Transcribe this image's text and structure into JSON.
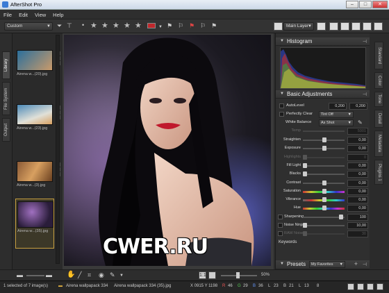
{
  "window": {
    "title": "AfterShot Pro",
    "min": "–",
    "max": "□",
    "close": "✕"
  },
  "menu": [
    "File",
    "Edit",
    "View",
    "Help"
  ],
  "toolbar": {
    "preset_dropdown": "Custom",
    "layer_dropdown": "Main Layer",
    "rating_stars": 5,
    "label_color": "#c0282c"
  },
  "left_tabs": [
    "Library",
    "File System",
    "Output"
  ],
  "thumbnails": [
    {
      "caption": "Airena w...(20).jpg",
      "colors": [
        "#2b6f9c",
        "#c99a6a"
      ]
    },
    {
      "caption": "Airena w...(23).jpg",
      "colors": [
        "#4c8ab8",
        "#e0e0d8"
      ]
    },
    {
      "caption": "Airena w...(3).jpg",
      "colors": [
        "#8a5a36",
        "#d8a060"
      ]
    },
    {
      "caption": "Airena w...(35).jpg",
      "colors": [
        "#2a1d3a",
        "#a070c0"
      ],
      "selected": true
    }
  ],
  "viewer": {
    "watermark": "CWER.RU",
    "zoom": "50%",
    "ratio_label": "1:1"
  },
  "panels": {
    "histogram": "Histogram",
    "basic": "Basic Adjustments",
    "presets": "Presets",
    "presets_dropdown": "My Favorites",
    "keywords": "Keywords"
  },
  "autolevel": {
    "label": "AutoLevel",
    "low": "0,200",
    "high": "0,200"
  },
  "perfectly_clear": {
    "label": "Perfectly Clear",
    "value": "Tint Off"
  },
  "white_balance": {
    "label": "White Balance",
    "value": "As Shot"
  },
  "temp": {
    "label": "Temp",
    "value": "5001"
  },
  "sliders": [
    {
      "label": "Straighten",
      "value": "0,00",
      "knob": 0.5,
      "enabled": true
    },
    {
      "label": "Exposure",
      "value": "0,00",
      "knob": 0.5,
      "enabled": true
    },
    {
      "label": "Highlights",
      "value": "0",
      "knob": 0.0,
      "enabled": false
    },
    {
      "label": "Fill Light",
      "value": "0,00",
      "knob": 0.0,
      "enabled": true
    },
    {
      "label": "Blacks",
      "value": "0,00",
      "knob": 0.0,
      "enabled": true
    },
    {
      "label": "Contrast",
      "value": "0,00",
      "knob": 0.5,
      "enabled": true
    },
    {
      "label": "Saturation",
      "value": "0,00",
      "knob": 0.5,
      "enabled": true
    },
    {
      "label": "Vibrance",
      "value": "0,00",
      "knob": 0.5,
      "enabled": true
    },
    {
      "label": "Hue",
      "value": "0,00",
      "knob": 0.5,
      "enabled": true
    },
    {
      "label": "Sharpening",
      "value": "100",
      "knob": 0.92,
      "enabled": true
    },
    {
      "label": "Noise Ninja",
      "value": "10,00",
      "knob": 0.0,
      "enabled": true
    },
    {
      "label": "RAW Noise",
      "value": "30",
      "knob": 0.0,
      "enabled": false
    }
  ],
  "right_tabs": [
    "Standard",
    "Color",
    "Tone",
    "Detail",
    "Metadata",
    "Plugins 1"
  ],
  "status": {
    "selection": "1 selected of 7 image(s)",
    "folder": "Airena wallpapack 334",
    "file": "Airena wallpapack 334 (35).jpg",
    "coords": "X 0915  Y 1198",
    "r": "R",
    "r_val": "46",
    "g": "G",
    "g_val": "29",
    "b": "B",
    "b_val": "36",
    "l": "L",
    "l_val": "23",
    "b2": "B",
    "b2_val": "21",
    "k": "L",
    "k_val": "13",
    "v": "8"
  }
}
